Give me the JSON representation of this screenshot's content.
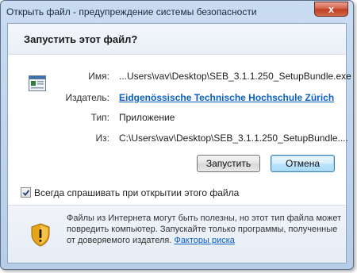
{
  "window": {
    "title": "Открыть файл - предупреждение системы безопасности",
    "close_glyph": "x"
  },
  "dialog": {
    "heading": "Запустить этот файл?",
    "fields": [
      {
        "label": "Имя:",
        "value": "...Users\\vav\\Desktop\\SEB_3.1.1.250_SetupBundle.exe"
      },
      {
        "label": "Издатель:",
        "value": "Eidgenössische Technische Hochschule Zürich"
      },
      {
        "label": "Тип:",
        "value": "Приложение"
      },
      {
        "label": "Из:",
        "value": "C:\\Users\\vav\\Desktop\\SEB_3.1.1.250_SetupBundle...."
      }
    ],
    "buttons": {
      "run": "Запустить",
      "cancel": "Отмена"
    },
    "checkbox": {
      "label": "Всегда спрашивать при открытии этого файла",
      "checked": true
    },
    "footer": {
      "text": "Файлы из Интернета могут быть полезны, но этот тип файла может повредить компьютер. Запускайте только программы, полученные от доверяемого издателя.",
      "link": "Факторы риска"
    }
  },
  "colors": {
    "link": "#0b5fbf",
    "close_button": "#c03c1e",
    "shield": "#e8a417"
  },
  "icons": [
    "application-icon",
    "shield-warning-icon",
    "close-icon",
    "checkmark-icon"
  ]
}
